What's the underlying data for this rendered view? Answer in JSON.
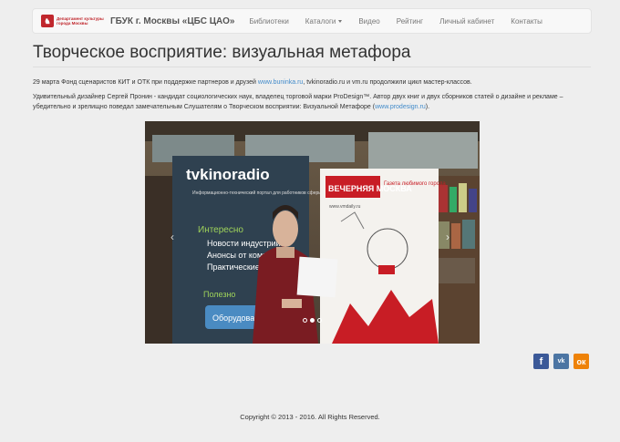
{
  "navbar": {
    "logo_text": "Департамент культуры города Москвы",
    "brand": "ГБУК г. Москвы «ЦБС ЦАО»",
    "items": [
      {
        "label": "Библиотеки"
      },
      {
        "label": "Каталоги"
      },
      {
        "label": "Видео"
      },
      {
        "label": "Рейтинг"
      },
      {
        "label": "Личный кабинет"
      },
      {
        "label": "Контакты"
      }
    ]
  },
  "article": {
    "title": "Творческое восприятие: визуальная метафора",
    "p1_a": "29 марта Фонд сценаристов КИТ и ОТК при поддержке партнеров и друзей ",
    "p1_link": "www.buninka.ru",
    "p1_b": ", tvkinoradio.ru и vm.ru продолжили цикл мастер-классов.",
    "p2_a": "Удивительный дизайнер Сергей Пронин - кандидат социологических наук, владелец торговой марки ProDesign™. Автор двух книг и двух сборников статей о дизайне и рекламе – убедительно и зрелищно поведал замечательным Слушателям о Творческом восприятии: Визуальной Метафоре (",
    "p2_link": "www.prodesign.ru",
    "p2_b": ")."
  },
  "photo": {
    "banner1_logo": "tvkinoradio",
    "banner1_sub": "Информационно-технический портал для работников сферы кино, радио и телевидения",
    "banner1_head": "Интересно",
    "banner1_items": [
      "Новости индустрии",
      "Анонсы от компаний",
      "Практические статьи"
    ],
    "banner1_foot": "Полезно",
    "banner1_button": "Оборудование",
    "banner2_logo": "ВЕЧЕРНЯЯ МОСКВА",
    "banner2_tag": "Газета любимого города",
    "banner2_url": "www.vmdaily.ru"
  },
  "carousel": {
    "prev": "‹",
    "next": "›",
    "slides": 3,
    "active": 1
  },
  "social": {
    "fb": "f",
    "vk": "vk",
    "ok": "ок"
  },
  "footer": {
    "text": "Copyright © 2013 - 2016. All Rights Reserved."
  }
}
